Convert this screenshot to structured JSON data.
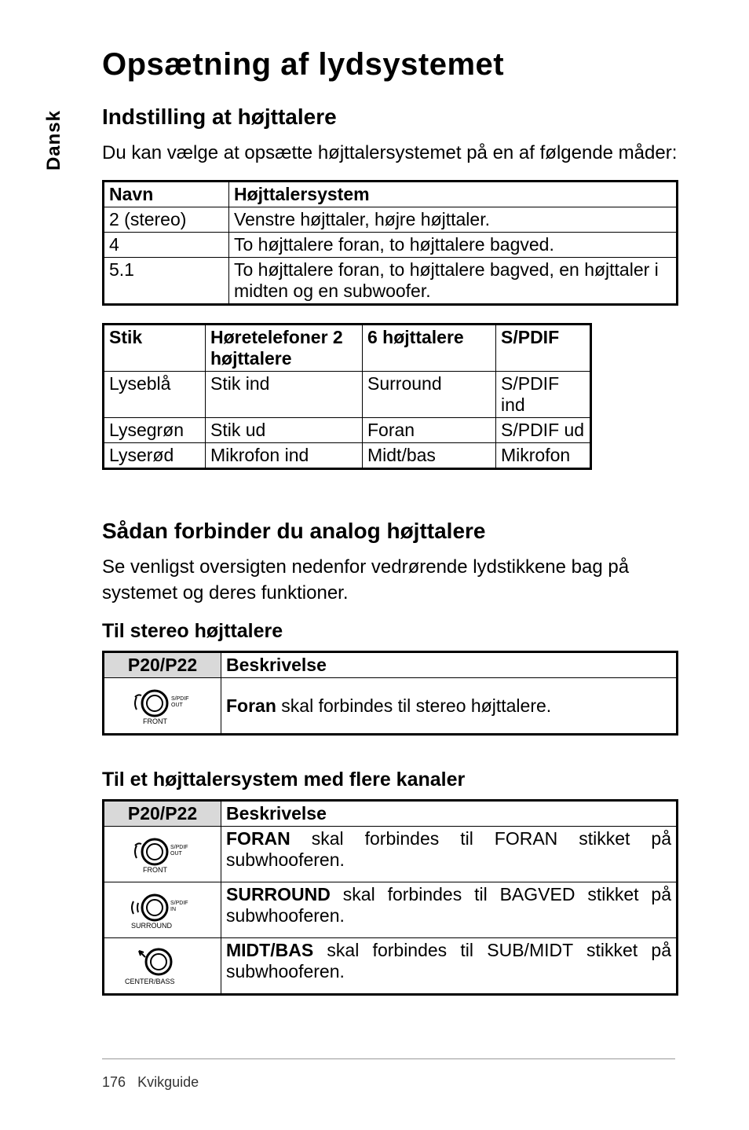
{
  "side_tab": "Dansk",
  "title": "Opsætning af lydsystemet",
  "section1": {
    "heading": "Indstilling at højttalere",
    "intro": "Du kan vælge at opsætte højttalersystemet på en af følgende måder:"
  },
  "table1": {
    "headers": {
      "name": "Navn",
      "system": "Højttalersystem"
    },
    "rows": [
      {
        "name": "2 (stereo)",
        "system": "Venstre højttaler, højre højttaler."
      },
      {
        "name": "4",
        "system": "To højttalere foran, to højttalere bagved."
      },
      {
        "name": "5.1",
        "system": "To højttalere foran, to højttalere bagved, en højttaler i midten og en subwoofer."
      }
    ]
  },
  "table2": {
    "headers": {
      "stik": "Stik",
      "hp2": "Høretelefoner 2 højttalere",
      "sp6": "6 højttalere",
      "spdif": "S/PDIF"
    },
    "rows": [
      {
        "stik": "Lyseblå",
        "hp2": "Stik ind",
        "sp6": "Surround",
        "spdif": "S/PDIF ind"
      },
      {
        "stik": "Lysegrøn",
        "hp2": "Stik ud",
        "sp6": "Foran",
        "spdif": "S/PDIF ud"
      },
      {
        "stik": "Lyserød",
        "hp2": "Mikrofon ind",
        "sp6": "Midt/bas",
        "spdif": "Mikrofon"
      }
    ]
  },
  "section2": {
    "heading": "Sådan forbinder du analog højttalere",
    "intro": "Se venligst oversigten nedenfor vedrørende lydstikkene bag på systemet og deres funktioner."
  },
  "stereo": {
    "heading": "Til stereo højttalere",
    "head_model": "P20/P22",
    "head_desc": "Beskrivelse",
    "row": {
      "bold": "Foran",
      "rest": " skal forbindes til stereo højttalere."
    },
    "icon": {
      "top": "S/PDIF OUT",
      "bottom": "FRONT"
    }
  },
  "multi": {
    "heading": "Til et højttalersystem med flere kanaler",
    "head_model": "P20/P22",
    "head_desc": "Beskrivelse",
    "rows": [
      {
        "bold": "FORAN",
        "rest": " skal forbindes til FORAN stikket på subwhooferen.",
        "icon_top": "S/PDIF OUT",
        "icon_bottom": "FRONT"
      },
      {
        "bold": "SURROUND",
        "rest": " skal forbindes til BAGVED stikket på subwhooferen.",
        "icon_top": "S/PDIF IN",
        "icon_bottom": "SURROUND"
      },
      {
        "bold": "MIDT/BAS",
        "rest": " skal forbindes til SUB/MIDT stikket på subwhooferen.",
        "icon_top": "",
        "icon_bottom": "CENTER/BASS"
      }
    ]
  },
  "footer": {
    "page": "176",
    "label": "Kvikguide"
  }
}
